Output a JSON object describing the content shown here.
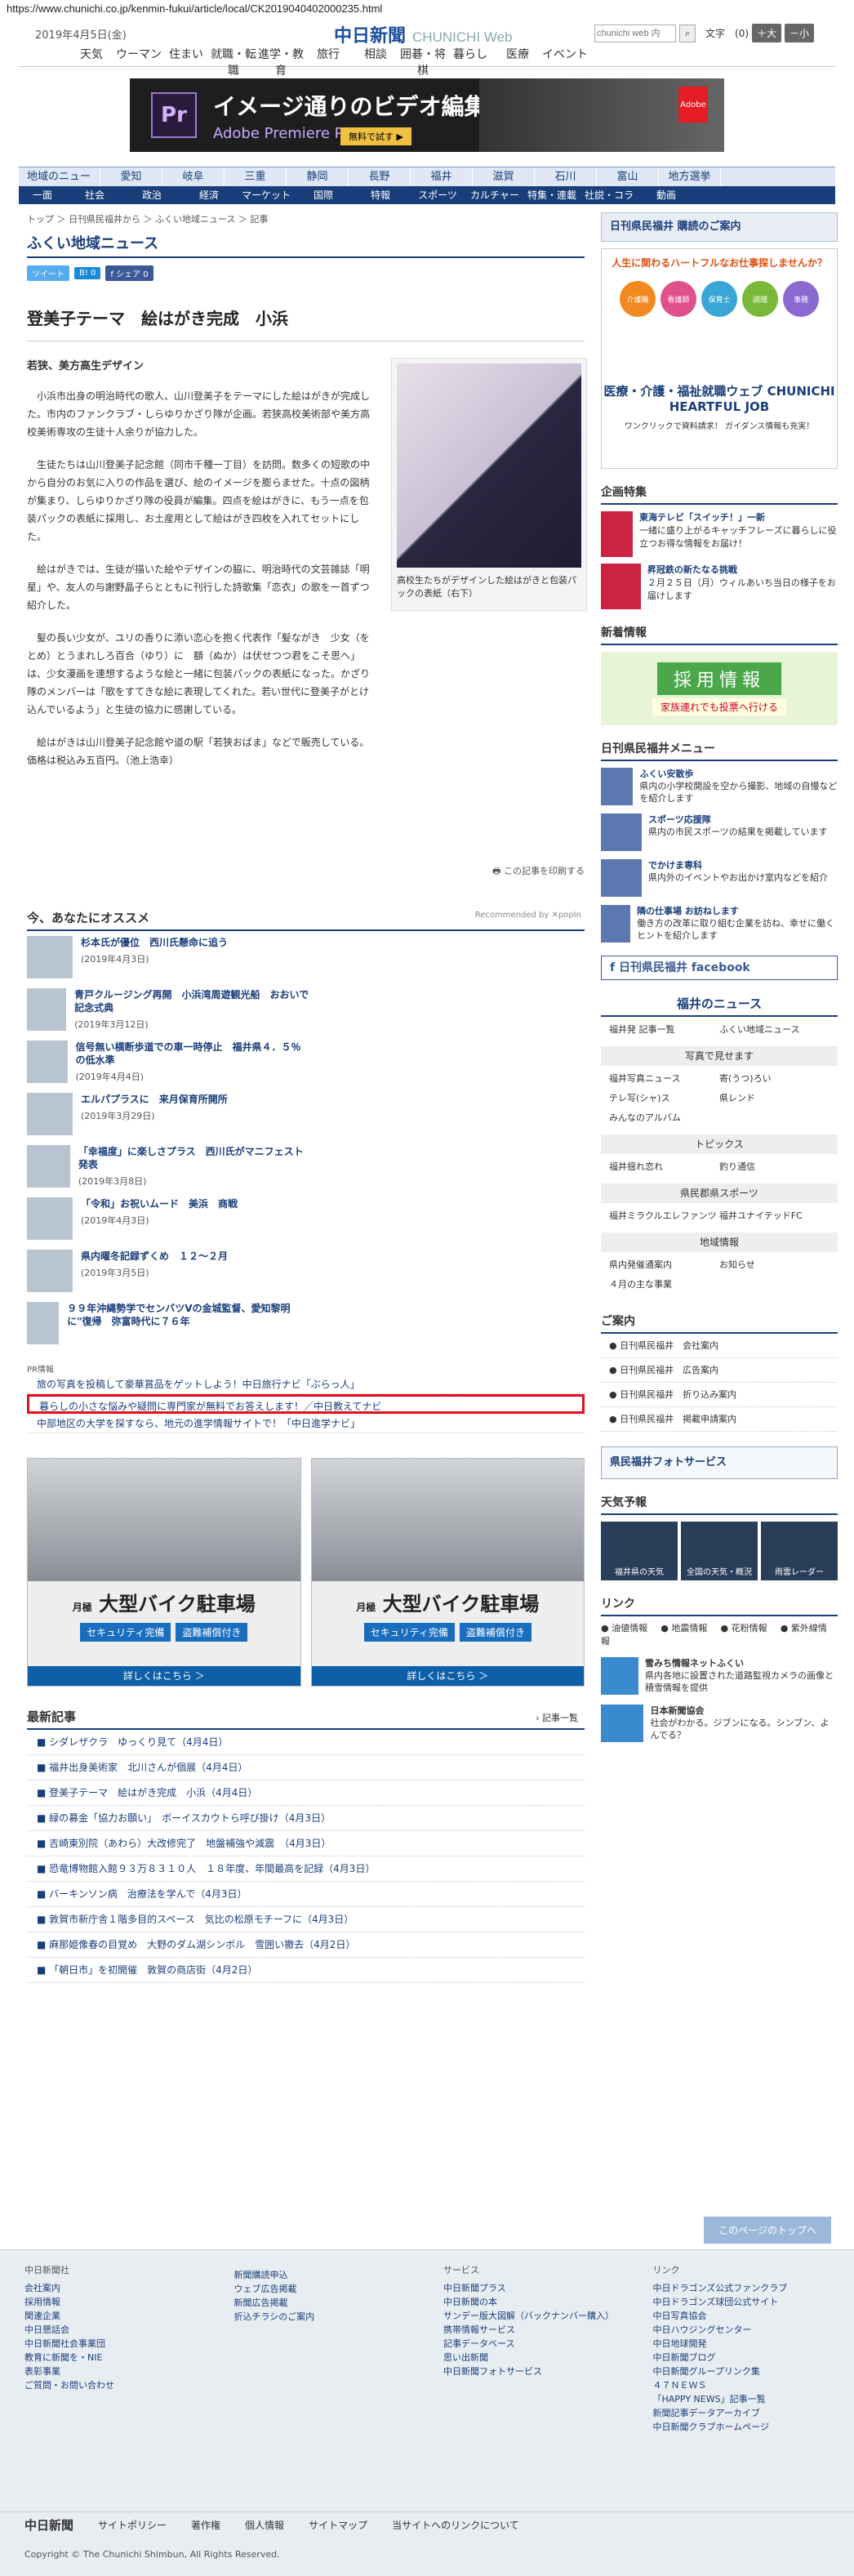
{
  "url": "https://www.chunichi.co.jp/kenmin-fukui/article/local/CK2019040402000235.html",
  "header": {
    "date": "2019年4月5日(金)",
    "logo": "中日新聞",
    "logo_sub": "CHUNICHI Web",
    "search_placeholder": "chunichi web 内",
    "font_size_label": "文字",
    "font_reset": "(0)",
    "font_large": "＋大",
    "font_small": "－小",
    "nav": [
      "天気",
      "ウーマン",
      "住まい",
      "就職・転職",
      "進学・教育",
      "旅行",
      "相談",
      "囲碁・将棋",
      "暮らし",
      "医療",
      "イベント"
    ]
  },
  "ad": {
    "logo": "Pr",
    "line1": "イメージ通りのビデオ編集を",
    "line2": "Adobe Premiere Pro CC",
    "button": "無料で試す ▶",
    "brand": "Adobe"
  },
  "nav1": [
    "地域のニュース",
    "愛知",
    "岐阜",
    "三重",
    "静岡",
    "長野",
    "福井",
    "滋賀",
    "石川",
    "富山",
    "地方選挙"
  ],
  "nav2": [
    "社会",
    "政治",
    "経済",
    "マーケット",
    "国際",
    "特報",
    "スポーツ",
    "カルチャー",
    "特集・連載",
    "社説・コラム",
    "動画"
  ],
  "nav2_first": "一面",
  "breadcrumb": "トップ ＞ 日刊県民福井から ＞ ふくい地域ニュース ＞ 記事",
  "section_title": "ふくい地域ニュース",
  "share": {
    "tweet": "ツイート",
    "hatena": "B! 0",
    "facebook": "f シェア 0"
  },
  "article": {
    "date": "2019年4月4日",
    "headline": "登美子テーマ　絵はがき完成　小浜",
    "subhead": "若狭、美方高生デザイン",
    "paragraphs": [
      "小浜市出身の明治時代の歌人、山川登美子をテーマにした絵はがきが完成した。市内のファンクラブ・しらゆりかざり隊が企画。若狭高校美術部や美方高校美術専攻の生徒十人余りが協力した。",
      "生徒たちは山川登美子記念館（同市千種一丁目）を訪問。数多くの短歌の中から自分のお気に入りの作品を選び、絵のイメージを膨らませた。十点の図柄が集まり、しらゆりかざり隊の役員が編集。四点を絵はがきに、もう一点を包装パックの表紙に採用し、お土産用として絵はがき四枚を入れてセットにした。",
      "絵はがきでは、生徒が描いた絵やデザインの脇に、明治時代の文芸雑誌「明星」や、友人の与謝野晶子らとともに刊行した詩歌集「恋衣」の歌を一首ずつ紹介した。",
      "髪の長い少女が、ユリの香りに添い恋心を抱く代表作「髪ながき　少女（をとめ）とうまれしろ百合（ゆり）に　額（ぬか）は伏せつつ君をこそ思へ」は、少女漫画を連想するような絵と一緒に包装パックの表紙になった。かざり隊のメンバーは「歌をすてきな絵に表現してくれた。若い世代に登美子がとけ込んでいるよう」と生徒の協力に感謝している。",
      "絵はがきは山川登美子記念館や道の駅「若狭おばま」などで販売している。価格は税込み五百円。（池上浩幸）"
    ],
    "photo_caption": "高校生たちがデザインした絵はがきと包装パックの表紙（右下）",
    "print": "この記事を印刷する"
  },
  "recommend": {
    "title": "今、あなたにオススメ",
    "by": "Recommended by ✕popIn",
    "items": [
      {
        "title": "杉本氏が優位　西川氏懸命に追う",
        "date": "(2019年4月3日)"
      },
      {
        "title": "青戸クルージング再開　小浜湾周遊観光船　おおいで記念式典",
        "date": "(2019年3月12日)"
      },
      {
        "title": "信号無い横断歩道での車一時停止　福井県４．５％の低水準",
        "date": "(2019年4月4日)"
      },
      {
        "title": "エルパプラスに　来月保育所開所",
        "date": "(2019年3月29日)"
      },
      {
        "title": "「幸福度」に楽しさプラス　西川氏がマニフェスト発表",
        "date": "(2019年3月8日)"
      },
      {
        "title": "「令和」お祝いムード　美浜　商戦",
        "date": "(2019年4月3日)"
      },
      {
        "title": "県内曜冬記録ずくめ　１２～２月",
        "date": "(2019年3月5日)"
      },
      {
        "title": "９９年沖縄勢学でセンバツVの金城監督、愛知黎明に\"復帰　弥富時代に７６年",
        "date": ""
      }
    ]
  },
  "pr": {
    "label": "PR情報",
    "items": [
      "旅の写真を投稿して豪華賞品をゲットしよう！中日旅行ナビ「ぶらっ人」",
      "暮らしの小さな悩みや疑問に専門家が無料でお答えします！／中日教えてナビ",
      "中部地区の大学を探すなら、地元の進学情報サイトで！「中日進学ナビ」"
    ]
  },
  "bike_ad": {
    "month": "月極",
    "title": "大型バイク駐車場",
    "tag1": "セキュリティ完備",
    "tag2": "盗難補償付き",
    "more": "詳しくはこちら ＞"
  },
  "latest": {
    "title": "最新記事",
    "more": "› 記事一覧",
    "items": [
      "シダレザクラ　ゆっくり見て（4月4日）",
      "福井出身美術家　北川さんが個展（4月4日）",
      "登美子テーマ　絵はがき完成　小浜（4月4日）",
      "緑の募金「協力お願い」　ボーイスカウトら呼び掛け（4月3日）",
      "吉崎東別院（あわら）大改修完了　地盤補強や減震　（4月3日）",
      "恐竜博物館入館９３万８３１０人　１８年度、年間最高を記録（4月3日）",
      "バーキンソン病　治療法を学んで（4月3日）",
      "敦賀市新庁舎１階多目的スペース　気比の松原モチーフに（4月3日）",
      "麻那姫像春の目覚め　大野のダム湖シンボル　雪囲い撤去（4月2日）",
      "「朝日市」を初開催　敦賀の商店街（4月2日）"
    ]
  },
  "right": {
    "banner": "日刊県民福井 購読のご案内",
    "job_tag": "人生に関わるハートフルなお仕事探しませんか？",
    "job_circles": [
      "介護職",
      "看護師",
      "保育士",
      "調理",
      "事務"
    ],
    "job_brand": "医療・介護・福祉就職ウェブ CHUNICHI HEARTFUL JOB",
    "job_sub": "ワンクリックで資料請求！ ガイダンス情報も充実！",
    "feature_title": "企画特集",
    "features": [
      {
        "title": "東海テレビ「スイッチ！」一新",
        "text": "一緒に盛り上がるキャッチフレーズに暮らしに役立つお得な情報をお届け！"
      },
      {
        "title": "昇冠鉄の新たなる挑戦",
        "text": "２月２５日（月）ウィルあいち当日の様子をお届けします"
      }
    ],
    "new_title": "新着情報",
    "recruit": "採用情報",
    "recruit_sub": "家族連れでも投票へ行ける",
    "menu_title": "日刊県民福井メニュー",
    "menu": [
      {
        "title": "ふくい安散歩",
        "text": "県内の小学校開設を空から撮影、地域の自慢などを紹介します"
      },
      {
        "title": "スポーツ応援隊",
        "text": "県内の市民スポーツの結果を掲載しています"
      },
      {
        "title": "でかけま専科",
        "text": "県内外のイベントやお出かけ室内などを紹介"
      },
      {
        "title": "隣の仕事場 お訪ねします",
        "text": "働き方の改革に取り組む企業を訪ね、幸せに働くヒントを紹介します"
      }
    ],
    "facebook": "日刊県民福井 facebook",
    "news_title": "福井のニュース",
    "news": [
      "福井発 記事一覧",
      "ふくい地域ニュース"
    ],
    "photo_sub": "写真で見せます",
    "photo_items": [
      "福井写真ニュース",
      "寄(うつ)ろい",
      "テレ写(シャ)ス",
      "県レンド",
      "みんなのアルバム"
    ],
    "topics_sub": "トピックス",
    "topics": [
      "福井揺れ恋れ",
      "釣り通信"
    ],
    "sports_sub": "県民郡県スポーツ",
    "sports": [
      "福井ミラクルエレファンツ",
      "福井ユナイテッドFC"
    ],
    "area_sub": "地域情報",
    "area": [
      "県内発催通案内",
      "お知らせ",
      "４月の主な事業"
    ],
    "guide_title": "ご案内",
    "guide": [
      "日刊県民福井　会社案内",
      "日刊県民福井　広告案内",
      "日刊県民福井　折り込み案内",
      "日刊県民福井　掲載申請案内"
    ],
    "photo_service": "県民福井フォトサービス",
    "weather_title": "天気予報",
    "weather": [
      "福井県の天気",
      "全国の天気・概況",
      "雨雲レーダー"
    ],
    "link_title": "リンク",
    "links": [
      "● 油値情報",
      "● 地震情報",
      "● 花粉情報",
      "● 紫外線情報"
    ],
    "link_items": [
      {
        "title": "雪みち情報ネットふくい",
        "text": "県内各地に設置された道路監視カメラの画像と積雪情報を提供"
      },
      {
        "title": "日本新聞協会",
        "text": "社会がわかる。ジブンになる。シンブン、よんでる？"
      }
    ]
  },
  "pagetop": "このページのトップへ",
  "footer": {
    "cols": [
      {
        "head": "中日新聞社",
        "items": [
          "会社案内",
          "採用情報",
          "関連企業",
          "中日懇話会",
          "中日新聞社会事業団",
          "教育に新聞を・NIE",
          "表彰事業",
          "ご質問・お問い合わせ"
        ]
      },
      {
        "head": "",
        "items": [
          "新聞購読申込",
          "ウェブ広告掲載",
          "新聞広告掲載",
          "折込チラシのご案内"
        ]
      },
      {
        "head": "サービス",
        "items": [
          "中日新聞プラス",
          "中日新聞の本",
          "サンデー版大図解（バックナンバー購入）",
          "携帯情報サービス",
          "記事データベース",
          "思い出新聞",
          "中日新聞フォトサービス"
        ]
      },
      {
        "head": "リンク",
        "items": [
          "中日ドラゴンズ公式ファンクラブ",
          "中日ドラゴンズ球団公式サイト",
          "中日写真協会",
          "中日ハウジングセンター",
          "中日地球開発",
          "中日新聞ブログ",
          "中日新聞グループリンク集",
          "４７ＮＥＷＳ",
          "「HAPPY NEWS」記事一覧",
          "新聞記事データアーカイブ",
          "中日新聞クラブホームページ"
        ]
      }
    ],
    "bottom_logo": "中日新聞",
    "bottom": [
      "サイトポリシー",
      "著作権",
      "個人情報",
      "サイトマップ",
      "当サイトへのリンクについて"
    ],
    "copyright": "Copyright © The Chunichi Shimbun, All Rights Reserved."
  }
}
